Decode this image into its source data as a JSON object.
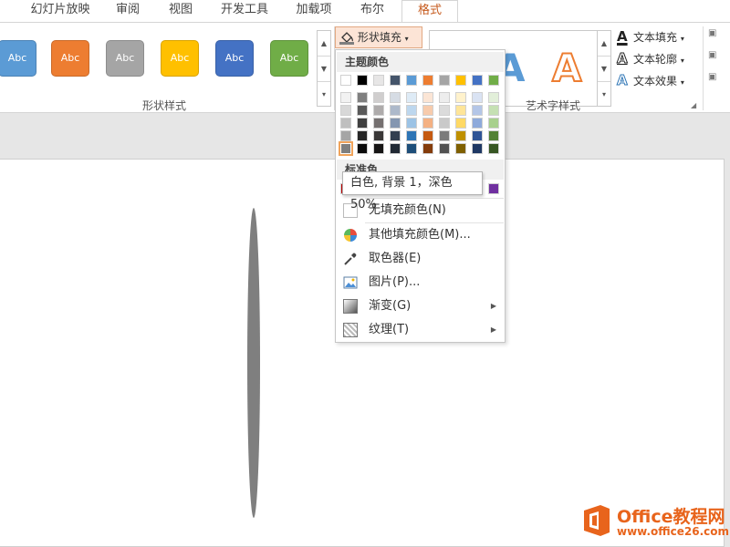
{
  "tabs": [
    "幻灯片放映",
    "审阅",
    "视图",
    "开发工具",
    "加载项",
    "布尔",
    "格式"
  ],
  "ribbon": {
    "shape_styles": [
      {
        "label": "Abc",
        "color": "#5b9bd5"
      },
      {
        "label": "Abc",
        "color": "#ed7d31"
      },
      {
        "label": "Abc",
        "color": "#a5a5a5"
      },
      {
        "label": "Abc",
        "color": "#ffc000"
      },
      {
        "label": "Abc",
        "color": "#4472c4"
      },
      {
        "label": "Abc",
        "color": "#70ad47"
      }
    ],
    "shape_styles_group_label": "形状样式",
    "shape_fill_label": "形状填充",
    "wordart_letter": "A",
    "wordart_group_label": "艺术字样式",
    "text_fill_label": "文本填充",
    "text_outline_label": "文本轮廓",
    "text_effects_label": "文本效果"
  },
  "dropdown": {
    "theme_header": "主题颜色",
    "theme_colors": [
      [
        "#ffffff",
        "#000000",
        "#e7e6e6",
        "#44546a",
        "#5b9bd5",
        "#ed7d31",
        "#a5a5a5",
        "#ffc000",
        "#4472c4",
        "#70ad47"
      ],
      [
        "#f2f2f2",
        "#7f7f7f",
        "#d0cece",
        "#d6dce4",
        "#deebf6",
        "#fbe5d5",
        "#ededed",
        "#fff2cc",
        "#dae3f3",
        "#e2efd9"
      ],
      [
        "#d8d8d8",
        "#595959",
        "#aeabab",
        "#adb9ca",
        "#bdd7ee",
        "#f7cbac",
        "#dbdbdb",
        "#fee599",
        "#b4c6e7",
        "#c5e0b3"
      ],
      [
        "#bfbfbf",
        "#3f3f3f",
        "#757070",
        "#8496b0",
        "#9cc3e5",
        "#f4b183",
        "#c9c9c9",
        "#ffd965",
        "#8eaadb",
        "#a8d08d"
      ],
      [
        "#a5a5a5",
        "#262626",
        "#3a3838",
        "#333f4f",
        "#2e75b5",
        "#c55a11",
        "#7b7b7b",
        "#bf9000",
        "#2f5496",
        "#538135"
      ],
      [
        "#7f7f7f",
        "#0c0c0c",
        "#171616",
        "#222a35",
        "#1e4e79",
        "#843c0b",
        "#525252",
        "#7f6000",
        "#1f3864",
        "#375623"
      ]
    ],
    "standard_header": "标准色",
    "standard_colors": [
      "#c00000",
      "#ff0000",
      "#ffc000",
      "#ffff00",
      "#92d050",
      "#00b050",
      "#00b0f0",
      "#0070c0",
      "#002060",
      "#7030a0"
    ],
    "no_fill": "无填充颜色(N)",
    "more_colors": "其他填充颜色(M)...",
    "eyedropper": "取色器(E)",
    "picture": "图片(P)...",
    "gradient": "渐变(G)",
    "texture": "纹理(T)"
  },
  "tooltip": "白色, 背景 1，深色 50%",
  "watermark": {
    "title": "Office教程网",
    "url": "www.office26.com"
  }
}
